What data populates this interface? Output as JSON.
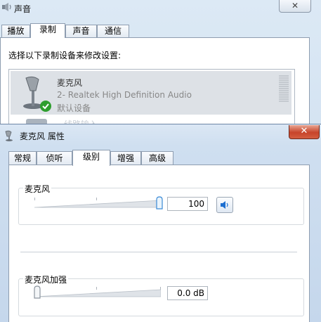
{
  "sound_dialog": {
    "title": "声音",
    "close_label": "✕",
    "tabs": [
      {
        "label": "播放",
        "selected": false
      },
      {
        "label": "录制",
        "selected": true
      },
      {
        "label": "声音",
        "selected": false
      },
      {
        "label": "通信",
        "selected": false
      }
    ],
    "instruction": "选择以下录制设备来修改设置:",
    "devices": [
      {
        "name": "麦克风",
        "description": "2- Realtek High Definition Audio",
        "status": "默认设备",
        "icon": "microphone-icon",
        "badge_icon": "green-check-icon"
      },
      {
        "name": "线路输入",
        "icon": "line-in-icon"
      }
    ]
  },
  "properties_dialog": {
    "title": "麦克风 属性",
    "close_label": "✕",
    "tabs": [
      {
        "label": "常规",
        "selected": false
      },
      {
        "label": "侦听",
        "selected": false
      },
      {
        "label": "级别",
        "selected": true
      },
      {
        "label": "增强",
        "selected": false
      },
      {
        "label": "高级",
        "selected": false
      }
    ],
    "microphone": {
      "label": "麦克风",
      "value": "100",
      "level": 1.0,
      "speaker_icon": "speaker-icon"
    },
    "boost": {
      "label": "麦克风加强",
      "value": "0.0 dB",
      "level": 0.0
    }
  },
  "colors": {
    "accent": "#1e6fd0",
    "close_red": "#c7442a",
    "check_green": "#2e9e2e"
  }
}
